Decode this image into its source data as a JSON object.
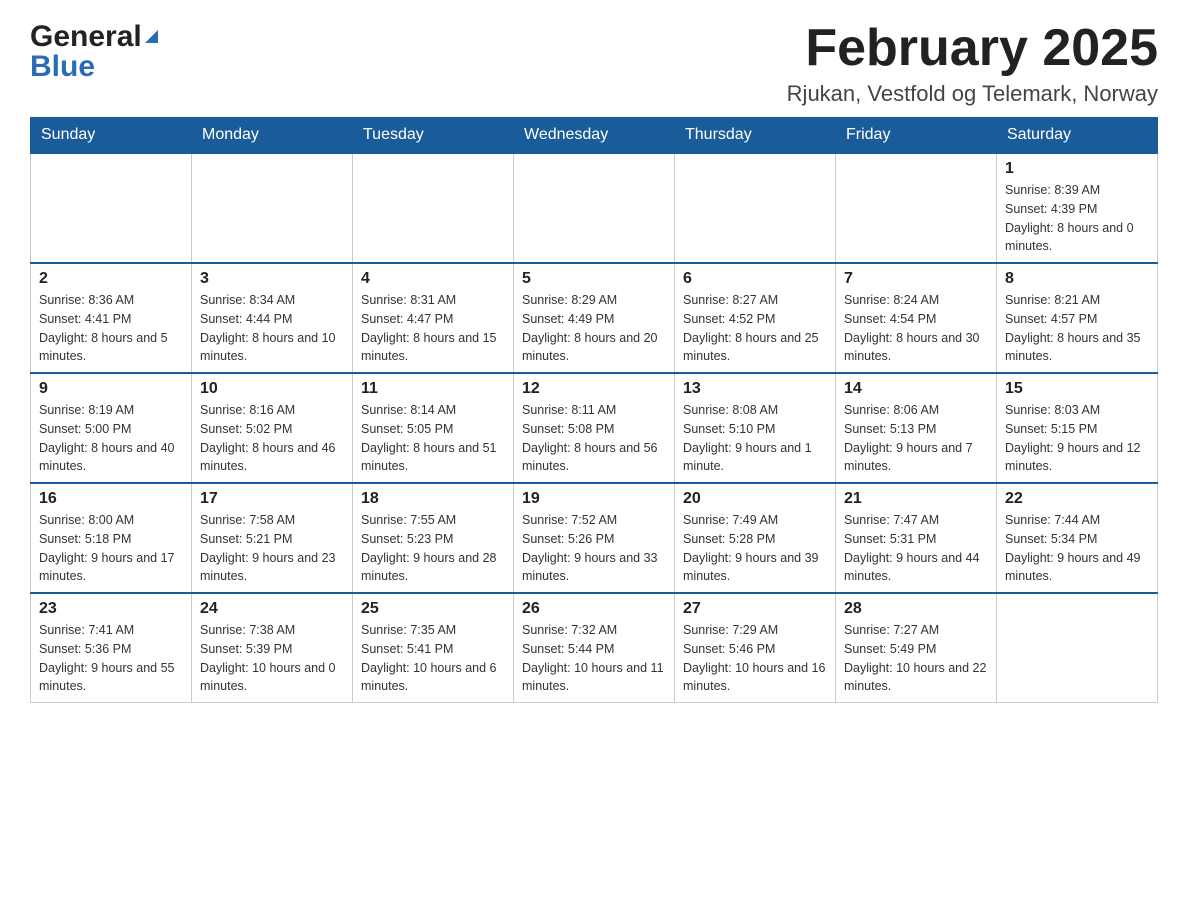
{
  "header": {
    "title": "February 2025",
    "location": "Rjukan, Vestfold og Telemark, Norway",
    "logo_general": "General",
    "logo_blue": "Blue"
  },
  "days_of_week": [
    "Sunday",
    "Monday",
    "Tuesday",
    "Wednesday",
    "Thursday",
    "Friday",
    "Saturday"
  ],
  "weeks": [
    [
      {
        "day": "",
        "info": ""
      },
      {
        "day": "",
        "info": ""
      },
      {
        "day": "",
        "info": ""
      },
      {
        "day": "",
        "info": ""
      },
      {
        "day": "",
        "info": ""
      },
      {
        "day": "",
        "info": ""
      },
      {
        "day": "1",
        "info": "Sunrise: 8:39 AM\nSunset: 4:39 PM\nDaylight: 8 hours and 0 minutes."
      }
    ],
    [
      {
        "day": "2",
        "info": "Sunrise: 8:36 AM\nSunset: 4:41 PM\nDaylight: 8 hours and 5 minutes."
      },
      {
        "day": "3",
        "info": "Sunrise: 8:34 AM\nSunset: 4:44 PM\nDaylight: 8 hours and 10 minutes."
      },
      {
        "day": "4",
        "info": "Sunrise: 8:31 AM\nSunset: 4:47 PM\nDaylight: 8 hours and 15 minutes."
      },
      {
        "day": "5",
        "info": "Sunrise: 8:29 AM\nSunset: 4:49 PM\nDaylight: 8 hours and 20 minutes."
      },
      {
        "day": "6",
        "info": "Sunrise: 8:27 AM\nSunset: 4:52 PM\nDaylight: 8 hours and 25 minutes."
      },
      {
        "day": "7",
        "info": "Sunrise: 8:24 AM\nSunset: 4:54 PM\nDaylight: 8 hours and 30 minutes."
      },
      {
        "day": "8",
        "info": "Sunrise: 8:21 AM\nSunset: 4:57 PM\nDaylight: 8 hours and 35 minutes."
      }
    ],
    [
      {
        "day": "9",
        "info": "Sunrise: 8:19 AM\nSunset: 5:00 PM\nDaylight: 8 hours and 40 minutes."
      },
      {
        "day": "10",
        "info": "Sunrise: 8:16 AM\nSunset: 5:02 PM\nDaylight: 8 hours and 46 minutes."
      },
      {
        "day": "11",
        "info": "Sunrise: 8:14 AM\nSunset: 5:05 PM\nDaylight: 8 hours and 51 minutes."
      },
      {
        "day": "12",
        "info": "Sunrise: 8:11 AM\nSunset: 5:08 PM\nDaylight: 8 hours and 56 minutes."
      },
      {
        "day": "13",
        "info": "Sunrise: 8:08 AM\nSunset: 5:10 PM\nDaylight: 9 hours and 1 minute."
      },
      {
        "day": "14",
        "info": "Sunrise: 8:06 AM\nSunset: 5:13 PM\nDaylight: 9 hours and 7 minutes."
      },
      {
        "day": "15",
        "info": "Sunrise: 8:03 AM\nSunset: 5:15 PM\nDaylight: 9 hours and 12 minutes."
      }
    ],
    [
      {
        "day": "16",
        "info": "Sunrise: 8:00 AM\nSunset: 5:18 PM\nDaylight: 9 hours and 17 minutes."
      },
      {
        "day": "17",
        "info": "Sunrise: 7:58 AM\nSunset: 5:21 PM\nDaylight: 9 hours and 23 minutes."
      },
      {
        "day": "18",
        "info": "Sunrise: 7:55 AM\nSunset: 5:23 PM\nDaylight: 9 hours and 28 minutes."
      },
      {
        "day": "19",
        "info": "Sunrise: 7:52 AM\nSunset: 5:26 PM\nDaylight: 9 hours and 33 minutes."
      },
      {
        "day": "20",
        "info": "Sunrise: 7:49 AM\nSunset: 5:28 PM\nDaylight: 9 hours and 39 minutes."
      },
      {
        "day": "21",
        "info": "Sunrise: 7:47 AM\nSunset: 5:31 PM\nDaylight: 9 hours and 44 minutes."
      },
      {
        "day": "22",
        "info": "Sunrise: 7:44 AM\nSunset: 5:34 PM\nDaylight: 9 hours and 49 minutes."
      }
    ],
    [
      {
        "day": "23",
        "info": "Sunrise: 7:41 AM\nSunset: 5:36 PM\nDaylight: 9 hours and 55 minutes."
      },
      {
        "day": "24",
        "info": "Sunrise: 7:38 AM\nSunset: 5:39 PM\nDaylight: 10 hours and 0 minutes."
      },
      {
        "day": "25",
        "info": "Sunrise: 7:35 AM\nSunset: 5:41 PM\nDaylight: 10 hours and 6 minutes."
      },
      {
        "day": "26",
        "info": "Sunrise: 7:32 AM\nSunset: 5:44 PM\nDaylight: 10 hours and 11 minutes."
      },
      {
        "day": "27",
        "info": "Sunrise: 7:29 AM\nSunset: 5:46 PM\nDaylight: 10 hours and 16 minutes."
      },
      {
        "day": "28",
        "info": "Sunrise: 7:27 AM\nSunset: 5:49 PM\nDaylight: 10 hours and 22 minutes."
      },
      {
        "day": "",
        "info": ""
      }
    ]
  ]
}
